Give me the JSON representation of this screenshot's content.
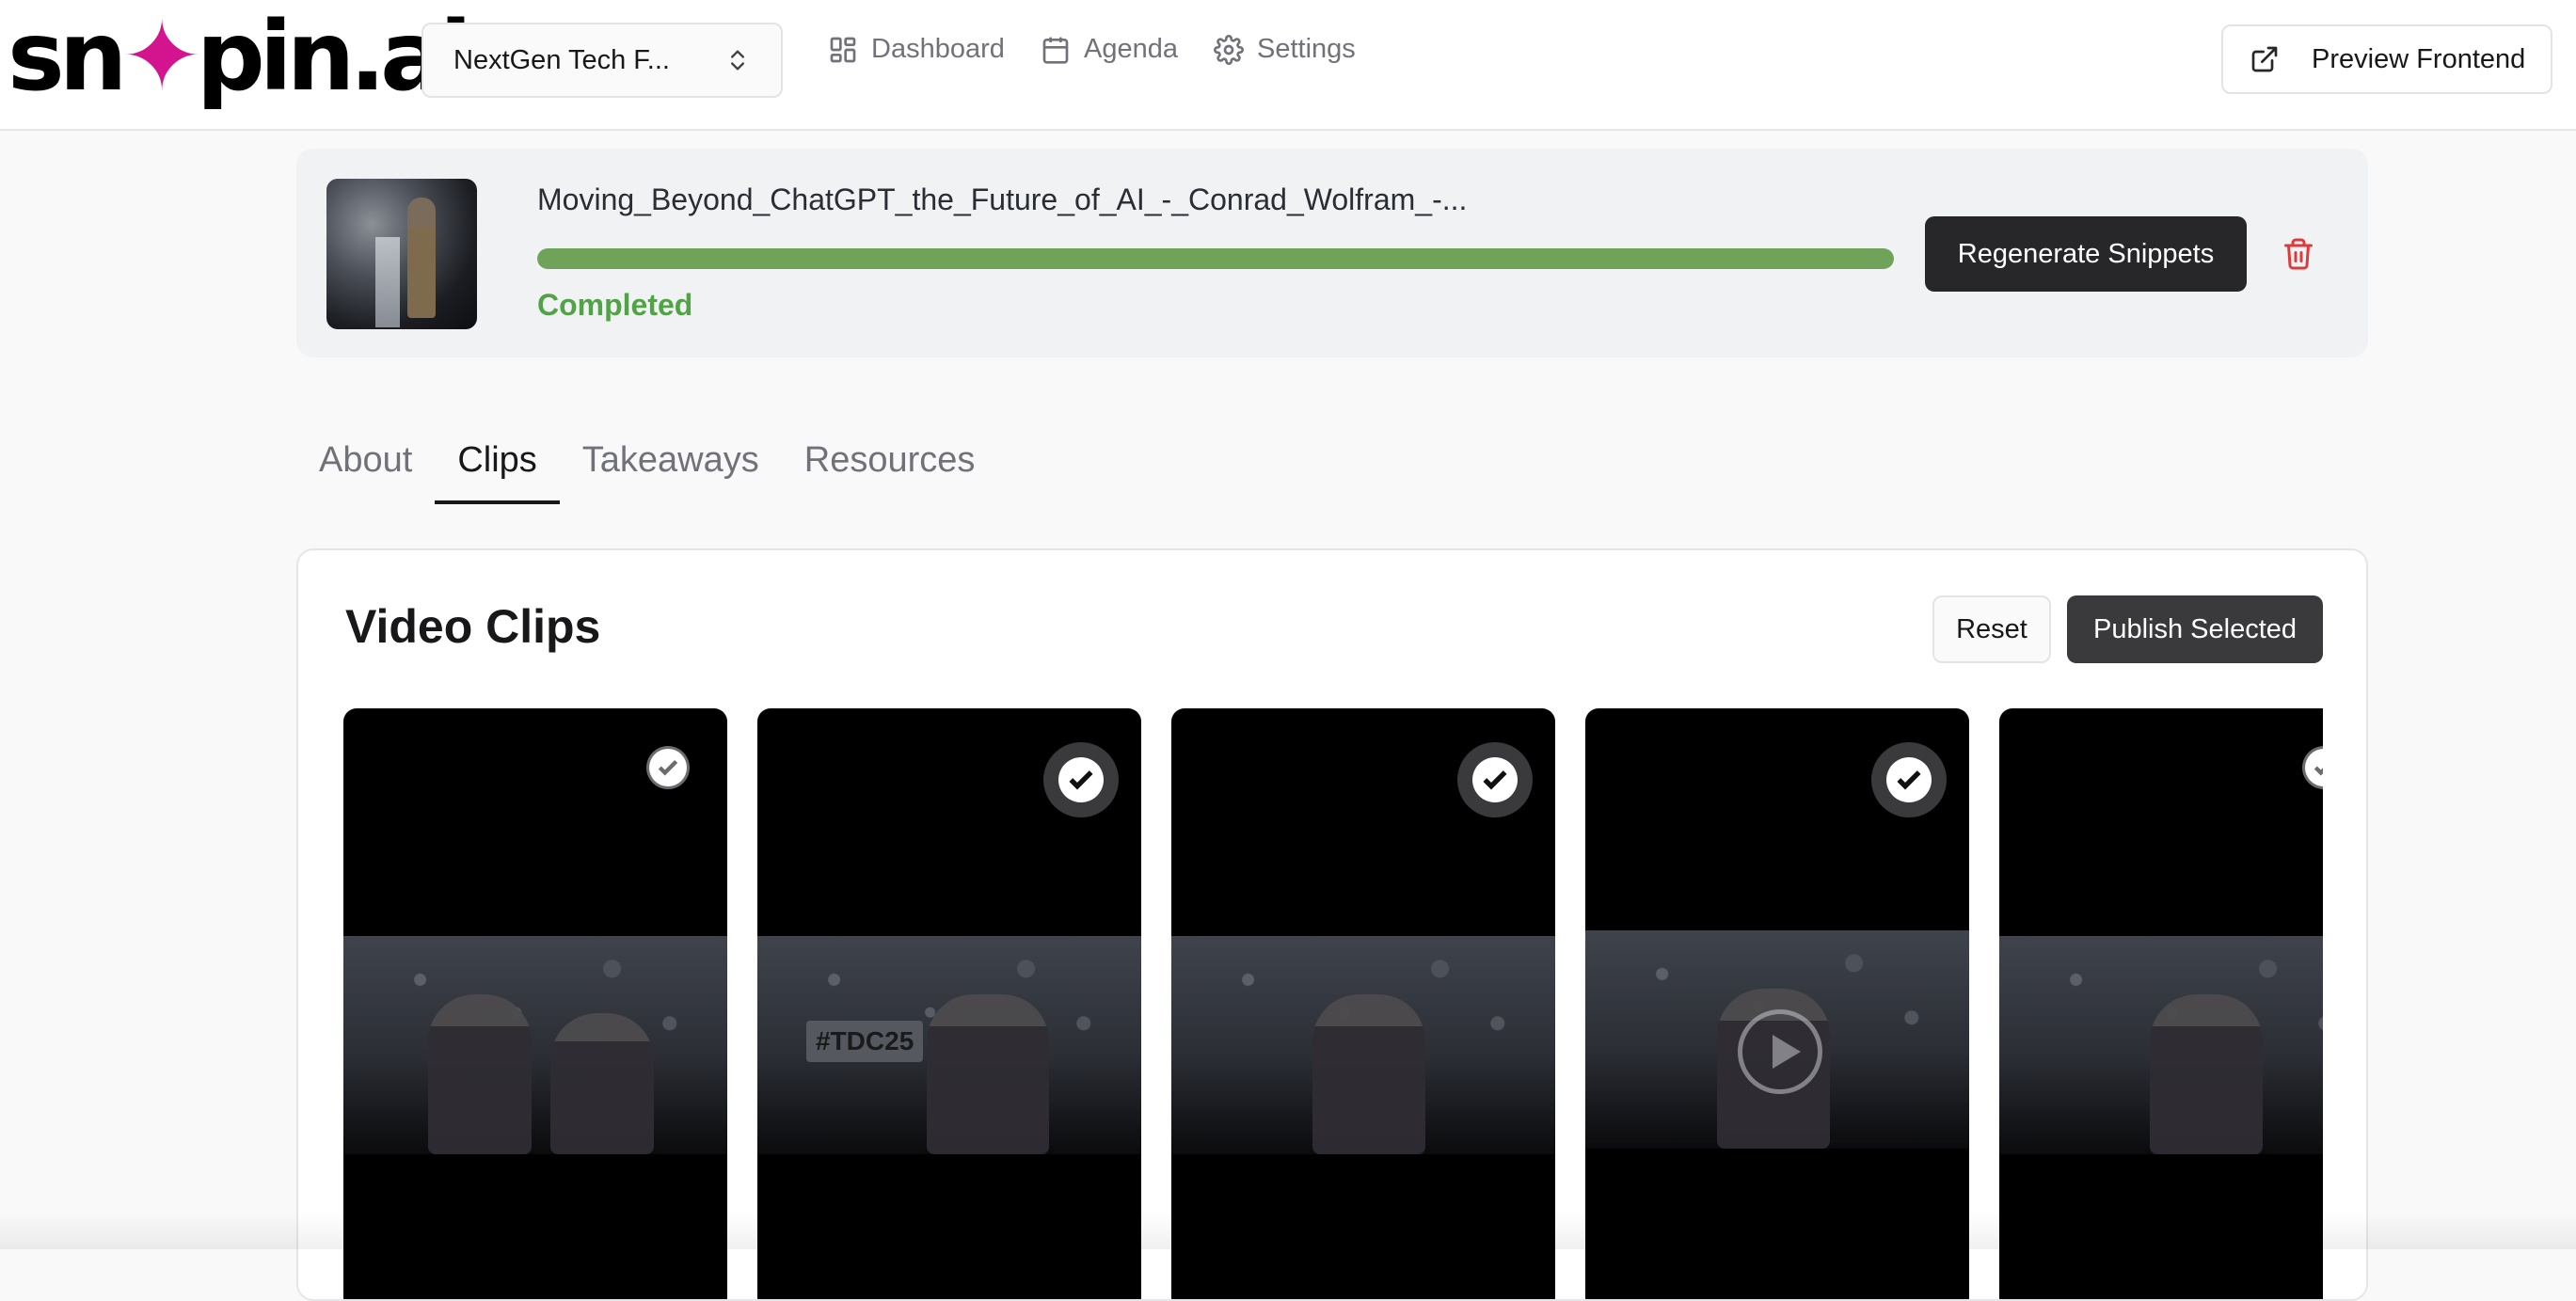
{
  "header": {
    "logo_text": "snipin.ai",
    "event_select": {
      "value": "NextGen Tech F..."
    },
    "nav": [
      {
        "label": "Dashboard",
        "icon": "dashboard-icon"
      },
      {
        "label": "Agenda",
        "icon": "calendar-icon"
      },
      {
        "label": "Settings",
        "icon": "gear-icon"
      }
    ],
    "preview_button": {
      "label": "Preview Frontend",
      "icon": "external-link-icon"
    }
  },
  "video_status": {
    "filename": "Moving_Beyond_ChatGPT_the_Future_of_AI_-_Conrad_Wolfram_-...",
    "progress_percent": 100,
    "status": "Completed",
    "regenerate_label": "Regenerate Snippets",
    "delete_icon": "trash-icon",
    "colors": {
      "progress": "#6fa35a",
      "status": "#52a347",
      "delete": "#dc3b3b"
    }
  },
  "tabs": {
    "items": [
      "About",
      "Clips",
      "Takeaways",
      "Resources"
    ],
    "active": "Clips"
  },
  "clips_panel": {
    "title": "Video Clips",
    "reset_label": "Reset",
    "publish_label": "Publish Selected",
    "clips": [
      {
        "selected": false,
        "overlay_text": ""
      },
      {
        "selected": true,
        "overlay_text": "#TDC25"
      },
      {
        "selected": true,
        "overlay_text": ""
      },
      {
        "selected": true,
        "overlay_text": "",
        "play_icon": "play-icon"
      },
      {
        "selected": false,
        "overlay_text": ""
      }
    ]
  }
}
